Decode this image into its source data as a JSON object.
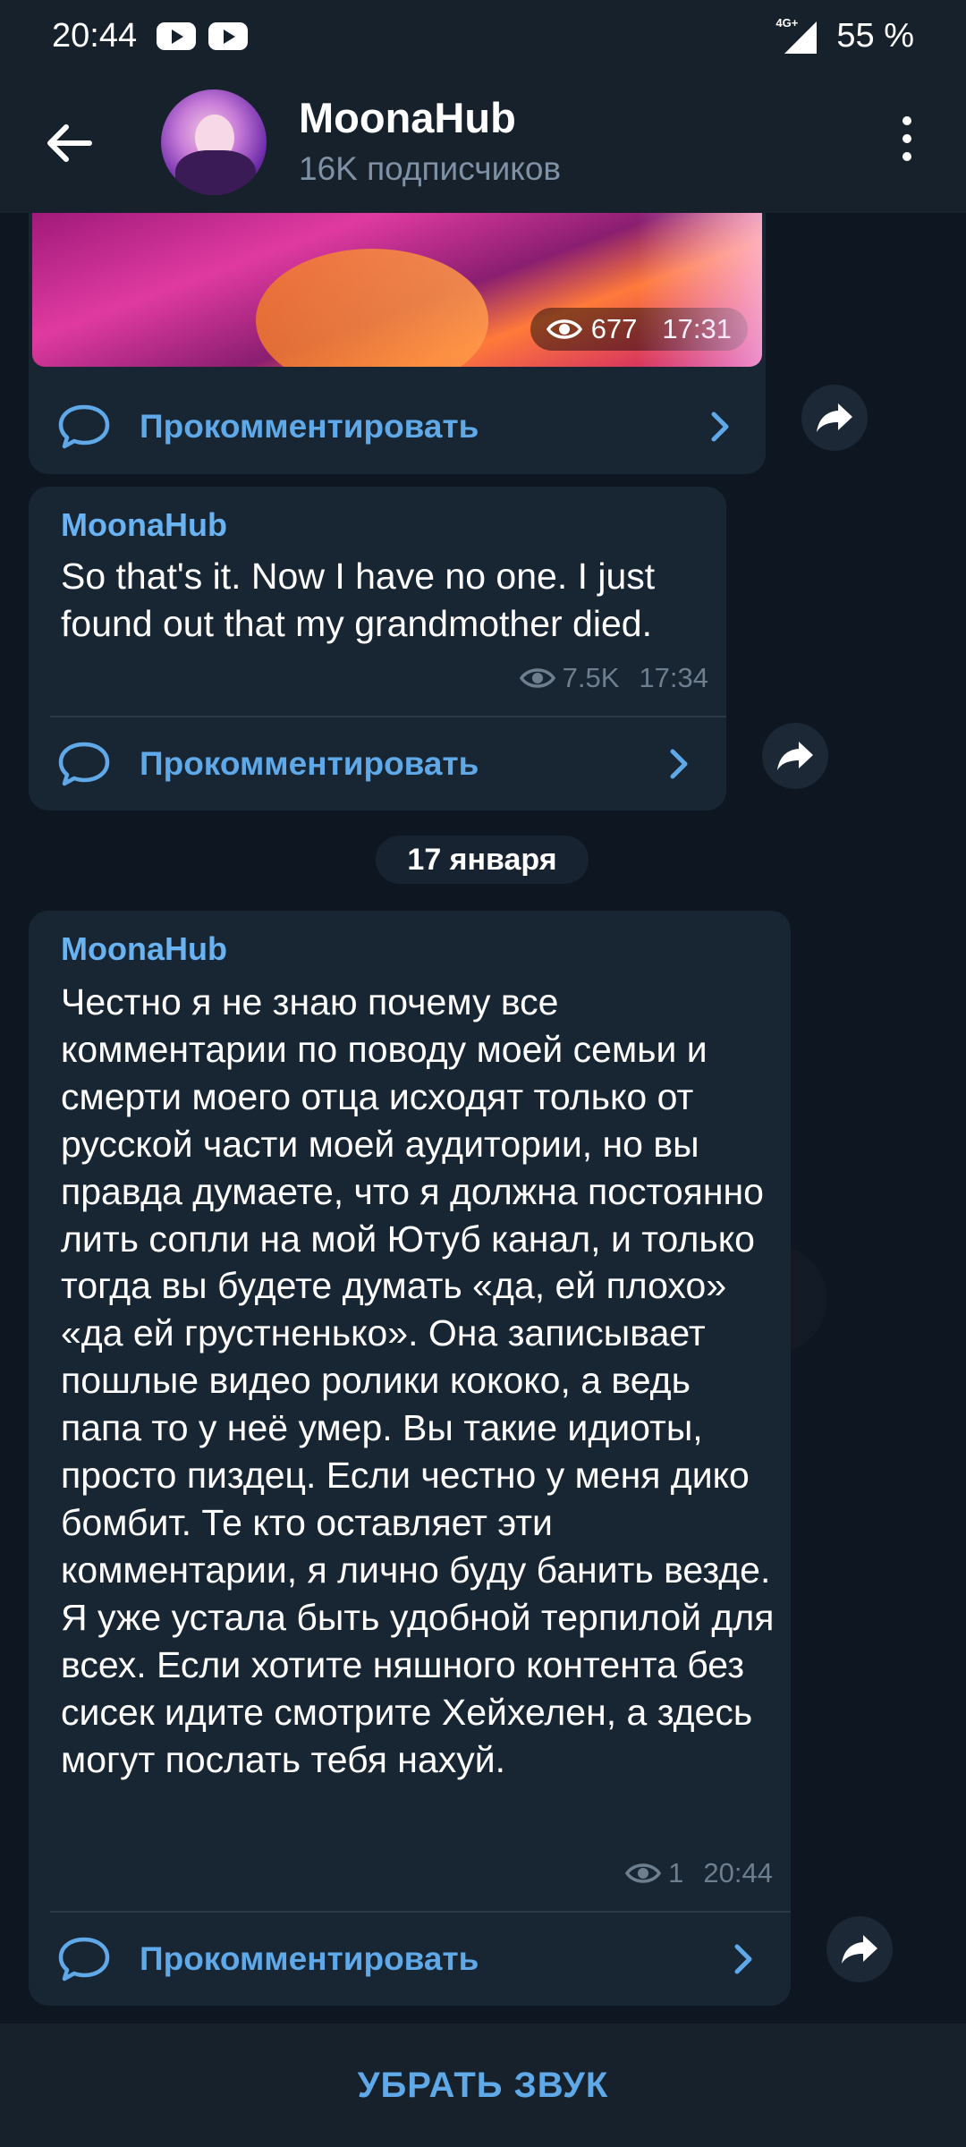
{
  "status_bar": {
    "time": "20:44",
    "battery": "55 %",
    "network": "4G+"
  },
  "header": {
    "title": "MoonaHub",
    "subtitle": "16K подписчиков"
  },
  "messages": [
    {
      "views": "677",
      "time": "17:31",
      "comment_label": "Прокомментировать"
    },
    {
      "sender": "MoonaHub",
      "text": "So that's it. Now I have no one. I just found out that my grandmother died.",
      "views": "7.5K",
      "time": "17:34",
      "comment_label": "Прокомментировать"
    },
    {
      "sender": "MoonaHub",
      "text": "Честно я не знаю почему все комментарии по поводу моей семьи и смерти моего отца исходят только от русской части моей аудитории, но вы правда думаете, что я должна постоянно лить сопли на мой Ютуб канал, и только тогда вы будете думать «да, ей плохо» «да ей грустненько». Она записывает пошлые видео ролики кококо, а ведь папа то у неё умер. Вы такие идиоты, просто пиздец. Если честно у меня дико бомбит. Те кто оставляет эти комментарии, я лично буду банить везде. Я уже устала быть удобной терпилой для всех. Если хотите няшного контента без сисек идите смотрите Хейхелен, а здесь могут послать тебя нахуй.",
      "views": "1",
      "time": "20:44",
      "comment_label": "Прокомментировать"
    }
  ],
  "date_separator": "17 января",
  "bottom_action": "УБРАТЬ ЗВУК",
  "colors": {
    "accent": "#5fa9e8",
    "bubble": "#182533",
    "background": "#0e1621",
    "bar": "#17212b"
  }
}
